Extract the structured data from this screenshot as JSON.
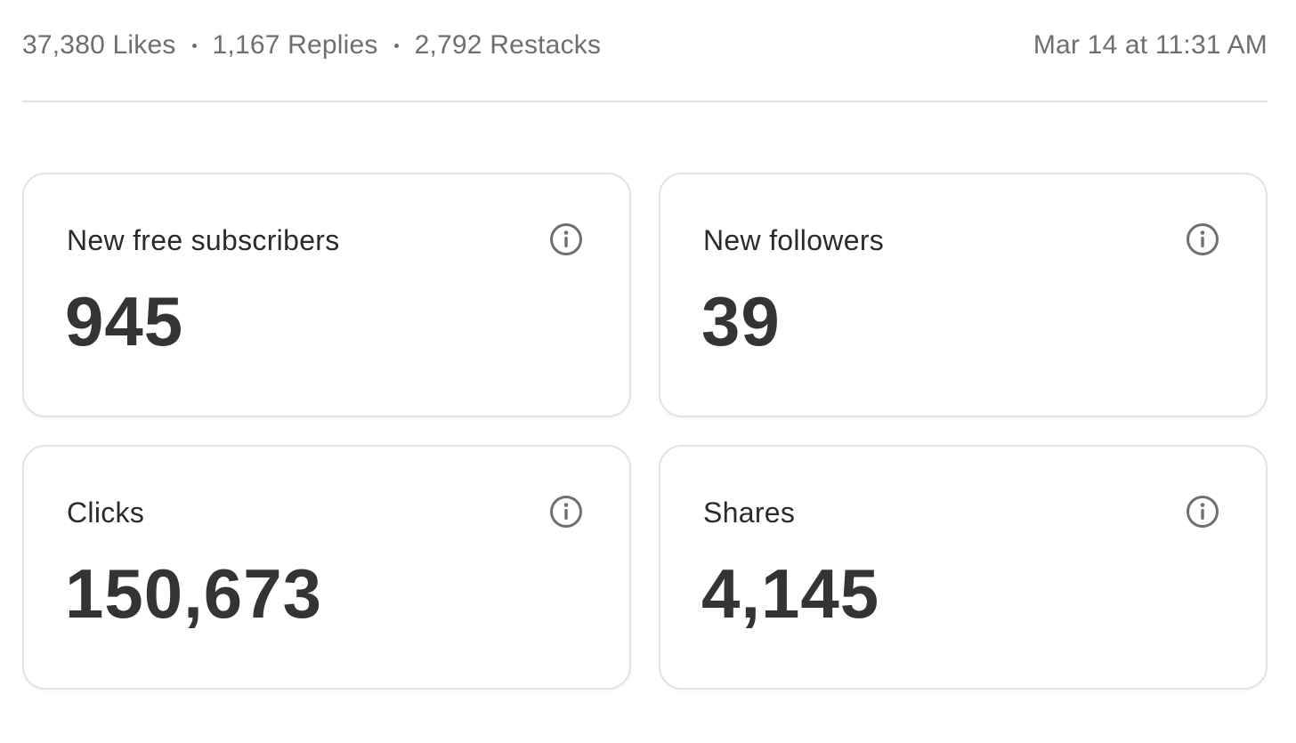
{
  "post_meta": {
    "likes": "37,380 Likes",
    "replies": "1,167 Replies",
    "restacks": "2,792 Restacks",
    "timestamp": "Mar 14 at 11:31 AM"
  },
  "cards": [
    {
      "label": "New free subscribers",
      "value": "945",
      "icon": "info-icon"
    },
    {
      "label": "New followers",
      "value": "39",
      "icon": "info-icon"
    },
    {
      "label": "Clicks",
      "value": "150,673",
      "icon": "info-icon"
    },
    {
      "label": "Shares",
      "value": "4,145",
      "icon": "info-icon"
    }
  ],
  "colors": {
    "text_muted": "#6f6f6f",
    "text_primary": "#2b2b2b",
    "value_text": "#333535",
    "card_border": "#e2e2e2",
    "divider": "#e3e3e3"
  }
}
